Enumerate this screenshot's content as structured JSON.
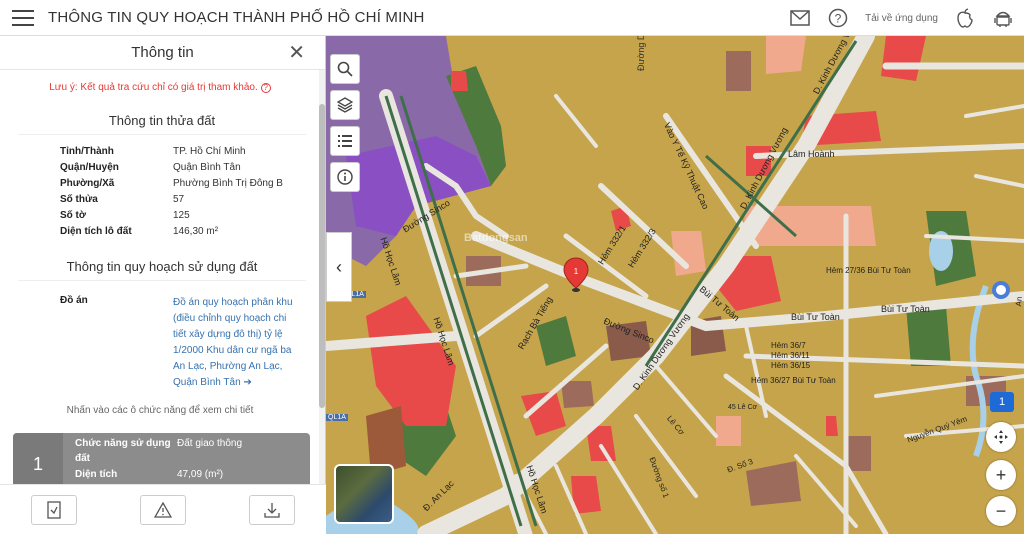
{
  "header": {
    "title": "THÔNG TIN QUY HOẠCH THÀNH PHỐ HỒ CHÍ MINH",
    "download_label": "Tải về ứng dụng"
  },
  "panel": {
    "title": "Thông tin",
    "note": "Lưu ý: Kết quả tra cứu chỉ có giá trị tham khảo.",
    "land_section_title": "Thông tin thửa đất",
    "land_info": [
      {
        "k": "Tỉnh/Thành",
        "v": "TP. Hồ Chí Minh"
      },
      {
        "k": "Quận/Huyện",
        "v": "Quận Bình Tân"
      },
      {
        "k": "Phường/Xã",
        "v": "Phường Bình Trị Đông B"
      },
      {
        "k": "Số thửa",
        "v": "57"
      },
      {
        "k": "Số tờ",
        "v": "125"
      },
      {
        "k": "Diện tích lô đất",
        "v": "146,30 m²"
      }
    ],
    "plan_section_title": "Thông tin quy hoạch sử dụng đất",
    "plan_label": "Đồ án",
    "plan_link": "Đồ án quy hoạch phân khu (điều chỉnh quy hoạch chi tiết xây dựng đô thị) tỷ lệ 1/2000 Khu dân cư ngã ba An Lạc, Phường An Lạc, Quận Bình Tân",
    "hint": "Nhấn vào các ô chức năng để xem chi tiết",
    "func_card": {
      "number": "1",
      "func_label": "Chức năng sử dụng đất",
      "func_value": "Đất giao thông",
      "area_label": "Diện tích",
      "area_value": "47,09 (m²)"
    }
  },
  "map": {
    "badge": "1",
    "labels": {
      "duong_d5": "Đường D5",
      "kinh_duong_vuong_1": "D. Kinh Dương Vương",
      "kinh_duong_vuong_2": "D. Kinh Dương Vương",
      "kinh_duong_vuong_3": "D. Kinh Dương Vương",
      "vao_y_te": "Vào Y Tế Kỹ Thuật Cao",
      "lam_hoanh": "Lâm Hoành",
      "duong_sinco_1": "Đường Sinco",
      "duong_sinco_2": "Đường Sinco",
      "ho_hoc_lam_1": "Hồ Học Lãm",
      "ho_hoc_lam_2": "Hồ Học Lãm",
      "ho_hoc_lam_3": "Hồ Học Lãm",
      "hem_332_1": "Hẻm 332/1",
      "hem_332_3": "Hẻm 332/3",
      "bui_tu_toan_1": "Bùi Tư Toàn",
      "bui_tu_toan_2": "Bùi Tư Toàn",
      "bui_tu_toan_3": "Bùi Tư Toàn",
      "hem_27_36": "Hẻm 27/36 Bùi Tư Toàn",
      "hem_36_7": "Hẻm 36/7",
      "hem_36_11": "Hẻm 36/11",
      "hem_36_15": "Hẻm 36/15",
      "hem_36_27": "Hẻm 36/27 Bùi Tư Toàn",
      "rach_ba_tieng": "Rạch Bà Tiếng",
      "an_lac": "Đ. An Lạc",
      "ql1a_1": "QL1A",
      "ql1a_2": "QL1A",
      "le_co": "Lê Cơ",
      "hem_45": "45 Lê Cơ",
      "so_3": "Đ. Số 3",
      "nguyen_quy_yem": "Nguyễn Quý Yêm",
      "an_duong_vuong": "An Dương Vương",
      "duong_so_1": "Đường số 1",
      "watermark": "Batdongsan"
    }
  }
}
